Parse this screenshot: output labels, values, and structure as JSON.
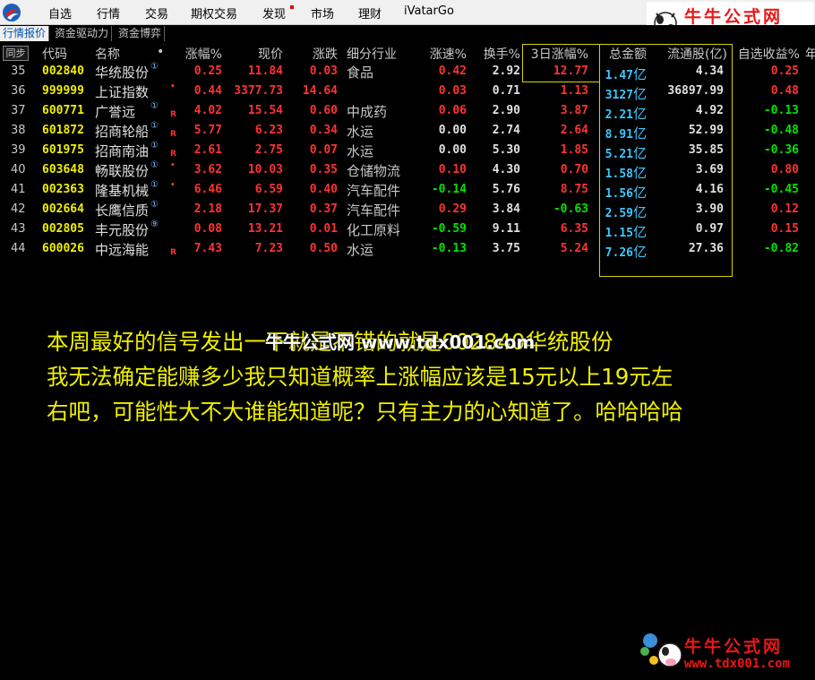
{
  "menu": {
    "items": [
      "自选",
      "行情",
      "交易",
      "期权交易",
      "发现",
      "市场",
      "理财",
      "iVatarGo"
    ]
  },
  "watermark": {
    "title": "牛牛公式网",
    "url": "www.tdx001.com",
    "overlay": "牛牛公式网 www.tdx001.com"
  },
  "tabs": [
    "行情报价",
    "资金驱动力",
    "资金博弈"
  ],
  "header": {
    "sync": "同步",
    "columns": [
      "代码",
      "名称",
      "•",
      "涨幅%",
      "现价",
      "涨跌",
      "细分行业",
      "涨速%",
      "换手%",
      "3日涨幅%",
      "总金额",
      "流通股(亿)",
      "自选收益%",
      "年"
    ]
  },
  "rows": [
    {
      "idx": "35",
      "code": "002840",
      "name": "华统股份",
      "flag": "①",
      "mark": "",
      "pct": "0.25",
      "price": "11.84",
      "chg": "0.03",
      "ind": "食品",
      "speed": "0.42",
      "turn": "2.92",
      "d3": "12.77",
      "amt": "1.47",
      "amt_unit": "亿",
      "float": "4.34",
      "ret": "0.25"
    },
    {
      "idx": "36",
      "code": "999999",
      "name": "上证指数",
      "flag": "",
      "mark": "•",
      "pct": "0.44",
      "price": "3377.73",
      "chg": "14.64",
      "ind": "",
      "speed": "0.03",
      "turn": "0.71",
      "d3": "1.13",
      "amt": "3127",
      "amt_unit": "亿",
      "float": "36897.99",
      "ret": "0.48"
    },
    {
      "idx": "37",
      "code": "600771",
      "name": "广誉远",
      "flag": "①",
      "mark": "R",
      "pct": "4.02",
      "price": "15.54",
      "chg": "0.60",
      "ind": "中成药",
      "speed": "0.06",
      "turn": "2.90",
      "d3": "3.87",
      "amt": "2.21",
      "amt_unit": "亿",
      "float": "4.92",
      "ret": "-0.13"
    },
    {
      "idx": "38",
      "code": "601872",
      "name": "招商轮船",
      "flag": "①",
      "mark": "R",
      "pct": "5.77",
      "price": "6.23",
      "chg": "0.34",
      "ind": "水运",
      "speed": "0.00",
      "turn": "2.74",
      "d3": "2.64",
      "amt": "8.91",
      "amt_unit": "亿",
      "float": "52.99",
      "ret": "-0.48"
    },
    {
      "idx": "39",
      "code": "601975",
      "name": "招商南油",
      "flag": "①",
      "mark": "R",
      "pct": "2.61",
      "price": "2.75",
      "chg": "0.07",
      "ind": "水运",
      "speed": "0.00",
      "turn": "5.30",
      "d3": "1.85",
      "amt": "5.21",
      "amt_unit": "亿",
      "float": "35.85",
      "ret": "-0.36"
    },
    {
      "idx": "40",
      "code": "603648",
      "name": "畅联股份",
      "flag": "①",
      "mark": "•",
      "pct": "3.62",
      "price": "10.03",
      "chg": "0.35",
      "ind": "仓储物流",
      "speed": "0.10",
      "turn": "4.30",
      "d3": "0.70",
      "amt": "1.58",
      "amt_unit": "亿",
      "float": "3.69",
      "ret": "0.80"
    },
    {
      "idx": "41",
      "code": "002363",
      "name": "隆基机械",
      "flag": "①",
      "mark": "•",
      "pct": "6.46",
      "price": "6.59",
      "chg": "0.40",
      "ind": "汽车配件",
      "speed": "-0.14",
      "turn": "5.76",
      "d3": "8.75",
      "amt": "1.56",
      "amt_unit": "亿",
      "float": "4.16",
      "ret": "-0.45"
    },
    {
      "idx": "42",
      "code": "002664",
      "name": "长鹰信质",
      "flag": "①",
      "mark": "",
      "pct": "2.18",
      "price": "17.37",
      "chg": "0.37",
      "ind": "汽车配件",
      "speed": "0.29",
      "turn": "3.84",
      "d3": "-0.63",
      "amt": "2.59",
      "amt_unit": "亿",
      "float": "3.90",
      "ret": "0.12"
    },
    {
      "idx": "43",
      "code": "002805",
      "name": "丰元股份",
      "flag": "⑨",
      "mark": "",
      "pct": "0.08",
      "price": "13.21",
      "chg": "0.01",
      "ind": "化工原料",
      "speed": "-0.59",
      "turn": "9.11",
      "d3": "6.35",
      "amt": "1.15",
      "amt_unit": "亿",
      "float": "0.97",
      "ret": "0.15"
    },
    {
      "idx": "44",
      "code": "600026",
      "name": "中远海能",
      "flag": "",
      "mark": "R",
      "pct": "7.43",
      "price": "7.23",
      "chg": "0.50",
      "ind": "水运",
      "speed": "-0.13",
      "turn": "3.75",
      "d3": "5.24",
      "amt": "7.26",
      "amt_unit": "亿",
      "float": "27.36",
      "ret": "-0.82"
    }
  ],
  "message": {
    "lines": [
      "本周最好的信号发出一下就是不错的就是002840华统股份",
      "我无法确定能赚多少我只知道概率上涨幅应该是15元以上19元左",
      "右吧，可能性大不大谁能知道呢？只有主力的心知道了。哈哈哈哈"
    ]
  },
  "colors": {
    "up": "#ff3232",
    "down": "#00e600",
    "highlight": "#f0f000",
    "amount": "#3cc8ff",
    "box": "#d8d000"
  }
}
